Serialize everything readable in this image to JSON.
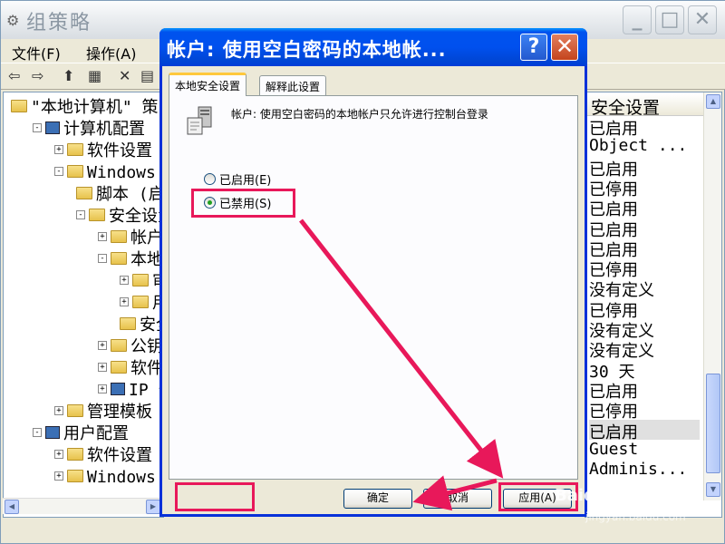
{
  "main_window": {
    "title": "组策略",
    "menu": [
      {
        "label": "文件(F)"
      },
      {
        "label": "操作(A)"
      }
    ],
    "tree": [
      {
        "label": "\"本地计算机\" 策",
        "indent": 0,
        "expander": "",
        "icon": "policy"
      },
      {
        "label": "计算机配置",
        "indent": 1,
        "expander": "-",
        "icon": "computer"
      },
      {
        "label": "软件设置",
        "indent": 2,
        "expander": "+",
        "icon": "folder"
      },
      {
        "label": "Windows 设",
        "indent": 2,
        "expander": "-",
        "icon": "folder"
      },
      {
        "label": "脚本 (启",
        "indent": 3,
        "expander": "",
        "icon": "script"
      },
      {
        "label": "安全设置",
        "indent": 3,
        "expander": "-",
        "icon": "folder"
      },
      {
        "label": "帐户策",
        "indent": 4,
        "expander": "+",
        "icon": "folder"
      },
      {
        "label": "本地策",
        "indent": 4,
        "expander": "-",
        "icon": "folder"
      },
      {
        "label": "审核",
        "indent": 5,
        "expander": "+",
        "icon": "folder"
      },
      {
        "label": "用户",
        "indent": 5,
        "expander": "+",
        "icon": "folder"
      },
      {
        "label": "安全",
        "indent": 5,
        "expander": "",
        "icon": "folder"
      },
      {
        "label": "公钥策",
        "indent": 4,
        "expander": "+",
        "icon": "folder"
      },
      {
        "label": "软件限",
        "indent": 4,
        "expander": "+",
        "icon": "folder"
      },
      {
        "label": "IP 安全",
        "indent": 4,
        "expander": "+",
        "icon": "computer"
      },
      {
        "label": "管理模板",
        "indent": 2,
        "expander": "+",
        "icon": "folder"
      },
      {
        "label": "用户配置",
        "indent": 1,
        "expander": "-",
        "icon": "user"
      },
      {
        "label": "软件设置",
        "indent": 2,
        "expander": "+",
        "icon": "folder"
      },
      {
        "label": "Windows 设",
        "indent": 2,
        "expander": "+",
        "icon": "folder"
      }
    ],
    "right_header": "安全设置",
    "right_values": [
      {
        "value": "已启用",
        "selected": false
      },
      {
        "value": "Object ...",
        "selected": false
      },
      {
        "value": "已启用",
        "selected": false
      },
      {
        "value": "已停用",
        "selected": false
      },
      {
        "value": "已启用",
        "selected": false
      },
      {
        "value": "已启用",
        "selected": false
      },
      {
        "value": "已启用",
        "selected": false
      },
      {
        "value": "已停用",
        "selected": false
      },
      {
        "value": "没有定义",
        "selected": false
      },
      {
        "value": "已停用",
        "selected": false
      },
      {
        "value": "没有定义",
        "selected": false
      },
      {
        "value": "没有定义",
        "selected": false
      },
      {
        "value": "30 天",
        "selected": false
      },
      {
        "value": "已启用",
        "selected": false
      },
      {
        "value": "已停用",
        "selected": false
      },
      {
        "value": "已启用",
        "selected": true
      },
      {
        "value": "Guest",
        "selected": false
      },
      {
        "value": "Adminis...",
        "selected": false
      }
    ]
  },
  "dialog": {
    "title": "帐户: 使用空白密码的本地帐...",
    "tabs": [
      {
        "label": "本地安全设置",
        "active": true
      },
      {
        "label": "解释此设置",
        "active": false
      }
    ],
    "description": "帐户: 使用空白密码的本地帐户只允许进行控制台登录",
    "options": [
      {
        "label": "已启用(E)",
        "selected": false
      },
      {
        "label": "已禁用(S)",
        "selected": true
      }
    ],
    "buttons": {
      "ok": "确定",
      "cancel": "取消",
      "apply": "应用(A)"
    }
  },
  "watermark": {
    "text": "Baidu 经验",
    "url": "jingyan.baidu.com"
  },
  "colors": {
    "dialog_title": "#0053ee",
    "highlight": "#e8185a",
    "close_button": "#c4441d"
  }
}
